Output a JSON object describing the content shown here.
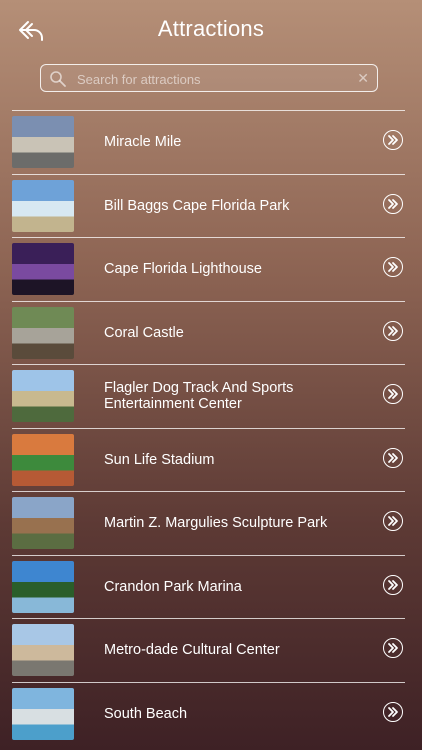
{
  "header": {
    "title": "Attractions"
  },
  "search": {
    "placeholder": "Search for attractions",
    "value": ""
  },
  "attractions": [
    {
      "label": "Miracle Mile",
      "thumb": [
        "#7b8fb1",
        "#c9c3b6",
        "#6c6c6a"
      ]
    },
    {
      "label": "Bill Baggs Cape Florida Park",
      "thumb": [
        "#6ea2d8",
        "#d7e8f2",
        "#c2b48e"
      ]
    },
    {
      "label": "Cape Florida Lighthouse",
      "thumb": [
        "#3a1f58",
        "#7a4aa0",
        "#1d1426"
      ]
    },
    {
      "label": "Coral Castle",
      "thumb": [
        "#6f8a55",
        "#a7a399",
        "#5a4b3b"
      ]
    },
    {
      "label": "Flagler Dog Track And Sports Entertainment Center",
      "thumb": [
        "#9ec4e8",
        "#c8b98f",
        "#4e6a3d"
      ]
    },
    {
      "label": "Sun Life Stadium",
      "thumb": [
        "#d97a3e",
        "#3d8a3c",
        "#b65a35"
      ]
    },
    {
      "label": "Martin Z. Margulies Sculpture Park",
      "thumb": [
        "#8aa5c8",
        "#98714f",
        "#5b6d42"
      ]
    },
    {
      "label": "Crandon Park Marina",
      "thumb": [
        "#3e86d0",
        "#2a5e2a",
        "#88b8d8"
      ]
    },
    {
      "label": "Metro-dade Cultural Center",
      "thumb": [
        "#a8c7e6",
        "#cdb99c",
        "#7a7770"
      ]
    },
    {
      "label": "South Beach",
      "thumb": [
        "#7fb5de",
        "#d8dfe2",
        "#4c9fcb"
      ]
    }
  ]
}
